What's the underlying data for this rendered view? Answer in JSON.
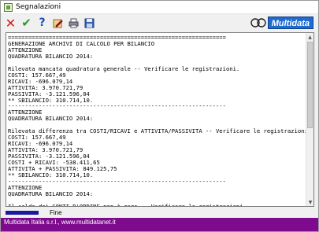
{
  "window": {
    "title": "Segnalazioni"
  },
  "toolbar": {
    "buttons": [
      {
        "icon": "close-icon"
      },
      {
        "icon": "check-icon"
      },
      {
        "icon": "help-icon"
      },
      {
        "icon": "edit-icon"
      },
      {
        "icon": "print-icon"
      },
      {
        "icon": "save-icon"
      }
    ]
  },
  "brand": {
    "name": "Multidata"
  },
  "report": {
    "lines": [
      "================================================================",
      "GENERAZIONE ARCHIVI DI CALCOLO PER BILANCIO",
      "ATTENZIONE",
      "QUADRATURA BILANCIO 2014:",
      "",
      "Rilevata mancata quadratura generale -- Verificare le registrazioni.",
      "COSTI: 157.667,49",
      "RICAVI: -696.079,14",
      "ATTIVITA: 3.970.721,79",
      "PASSIVITA: -3.121.596,04",
      "** SBILANCIO: 310.714,10.",
      "----------------------------------------------------------------",
      "ATTENZIONE",
      "QUADRATURA BILANCIO 2014:",
      "",
      "Rilevata differenza tra COSTI/RICAVI e ATTIVITA/PASSIVITA -- Verificare le registrazioni.",
      "COSTI: 157.667,49",
      "RICAVI: -696.079,14",
      "ATTIVITA: 3.970.721,79",
      "PASSIVITA: -3.121.596,04",
      "COSTI + RICAVI: -538.411,65",
      "ATTIVITA + PASSIVITA: 849.125,75",
      "** SBILANCIO: 310.714,10.",
      "----------------------------------------------------------------",
      "ATTENZIONE",
      "QUADRATURA BILANCIO 2014:",
      "",
      "Il saldo dei CONTI D'ORDINE non è zero -- Verificare le registrazioni."
    ]
  },
  "progress": {
    "label": "Fine",
    "value": 1.0
  },
  "footer": {
    "text": "Multidata Italia s.r.l., www.multidatanet.it"
  },
  "colors": {
    "footer": "#7e0a8e",
    "progress": "#1a1aa0",
    "brand": "#1f6bd0"
  }
}
